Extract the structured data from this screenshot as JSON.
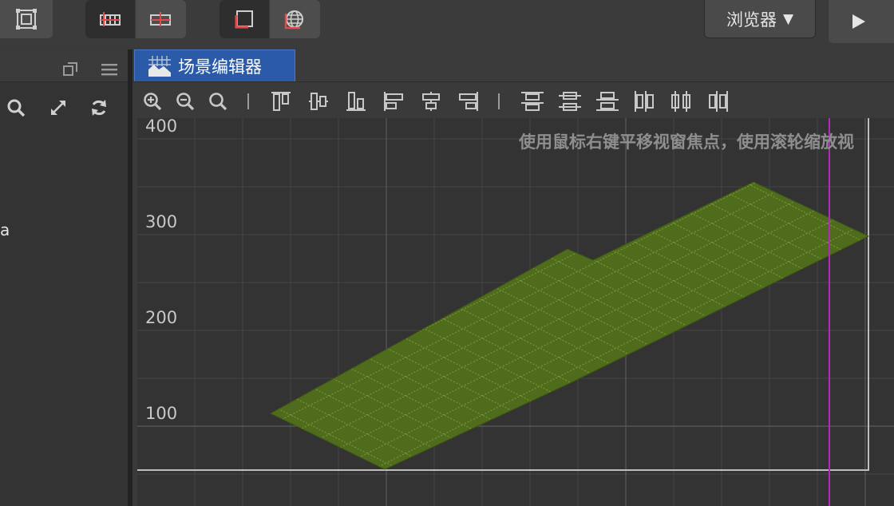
{
  "toolbar": {
    "browser_label": "浏览器",
    "browser_caret": "▼",
    "play_icon": "play-icon"
  },
  "scene_editor": {
    "tab_label": "场景编辑器",
    "hint_text": "使用鼠标右键平移视窗焦点，使用滚轮缩放视",
    "y_axis_labels": [
      "400",
      "300",
      "200",
      "100"
    ]
  },
  "left_panel": {
    "partial_text": "a"
  },
  "colors": {
    "tab_active": "#2b5aa8",
    "grass": "#4f6b1c",
    "guide_line": "#b02bb8",
    "toolbar_accent": "#e34a4a"
  }
}
